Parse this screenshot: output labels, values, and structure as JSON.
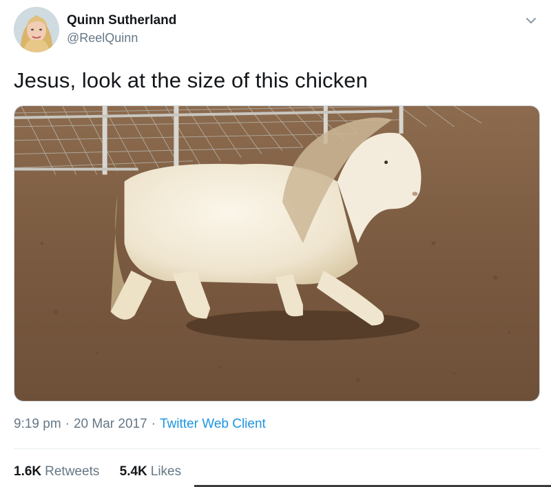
{
  "user": {
    "display_name": "Quinn Sutherland",
    "handle": "@ReelQuinn"
  },
  "tweet": {
    "text": "Jesus, look at the size of this chicken"
  },
  "meta": {
    "time": "9:19 pm",
    "separator": "·",
    "date": "20 Mar 2017",
    "client": "Twitter Web Client"
  },
  "stats": {
    "retweets_count": "1.6K",
    "retweets_label": "Retweets",
    "likes_count": "5.4K",
    "likes_label": "Likes"
  },
  "colors": {
    "link": "#1b95e0",
    "secondary_text": "#657786",
    "primary_text": "#14171a"
  },
  "icons": {
    "menu": "chevron-down-icon"
  }
}
